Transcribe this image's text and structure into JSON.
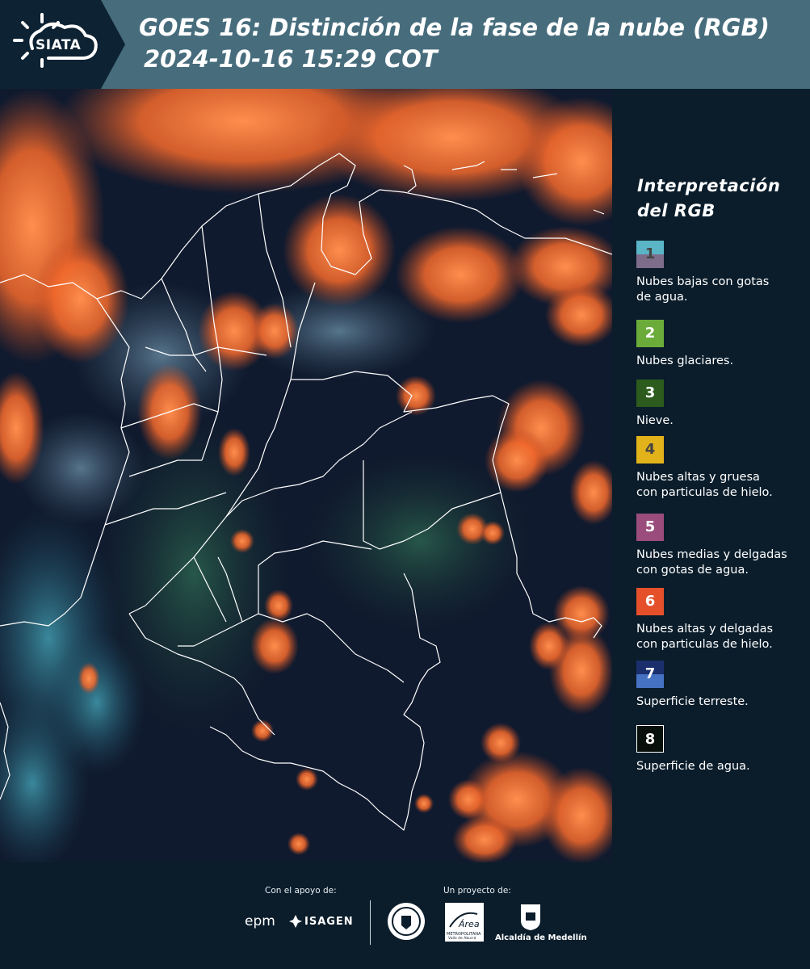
{
  "header": {
    "logo_text": "SIATA",
    "title_line1": "GOES 16: Distinción de la fase de la nube (RGB)",
    "title_line2": "2024-10-16 15:29 COT"
  },
  "legend": {
    "title_line1": "Interpretación",
    "title_line2": "del RGB",
    "items": [
      {
        "number": "1",
        "colors": [
          "#5ab6c6",
          "#7d6d8b"
        ],
        "num_color": "#444444",
        "text_line1": "Nubes bajas con gotas",
        "text_line2": "de agua."
      },
      {
        "number": "2",
        "colors": [
          "#6aab3a"
        ],
        "num_color": "#ffffff",
        "text_line1": "Nubes glaciares.",
        "text_line2": ""
      },
      {
        "number": "3",
        "colors": [
          "#2c5b1d"
        ],
        "num_color": "#ffffff",
        "text_line1": "Nieve.",
        "text_line2": ""
      },
      {
        "number": "4",
        "colors": [
          "#e2b21a"
        ],
        "num_color": "#444444",
        "text_line1": "Nubes altas y gruesa",
        "text_line2": "con particulas de hielo."
      },
      {
        "number": "5",
        "colors": [
          "#9a4c7c"
        ],
        "num_color": "#ffffff",
        "text_line1": "Nubes medias y delgadas",
        "text_line2": "con gotas de agua."
      },
      {
        "number": "6",
        "colors": [
          "#e5502b"
        ],
        "num_color": "#ffffff",
        "text_line1": "Nubes altas y delgadas",
        "text_line2": "con particulas de hielo."
      },
      {
        "number": "7",
        "colors": [
          "#1b2f6d",
          "#4672c4"
        ],
        "num_color": "#ffffff",
        "text_line1": "Superficie terreste.",
        "text_line2": ""
      },
      {
        "number": "8",
        "colors": [
          "#07100b"
        ],
        "num_color": "#ffffff",
        "text_line1": "Superficie de agua.",
        "text_line2": ""
      }
    ]
  },
  "footer": {
    "support_label": "Con el apoyo de:",
    "project_label": "Un proyecto de:",
    "epm": "epm",
    "isagen": "ISAGEN",
    "area_logo_line1": "Área",
    "area_logo_line2": "METROPOLITANA",
    "area_logo_line3": "Valle de Aburrá",
    "alcaldia": "Alcaldía de Medellín"
  },
  "colors": {
    "header_bg": "#476d7d",
    "logo_bg": "#0d2233",
    "page_bg": "#0b1d2b",
    "cloud_orange": "#ff7a3a",
    "border_white": "#ffffff"
  }
}
